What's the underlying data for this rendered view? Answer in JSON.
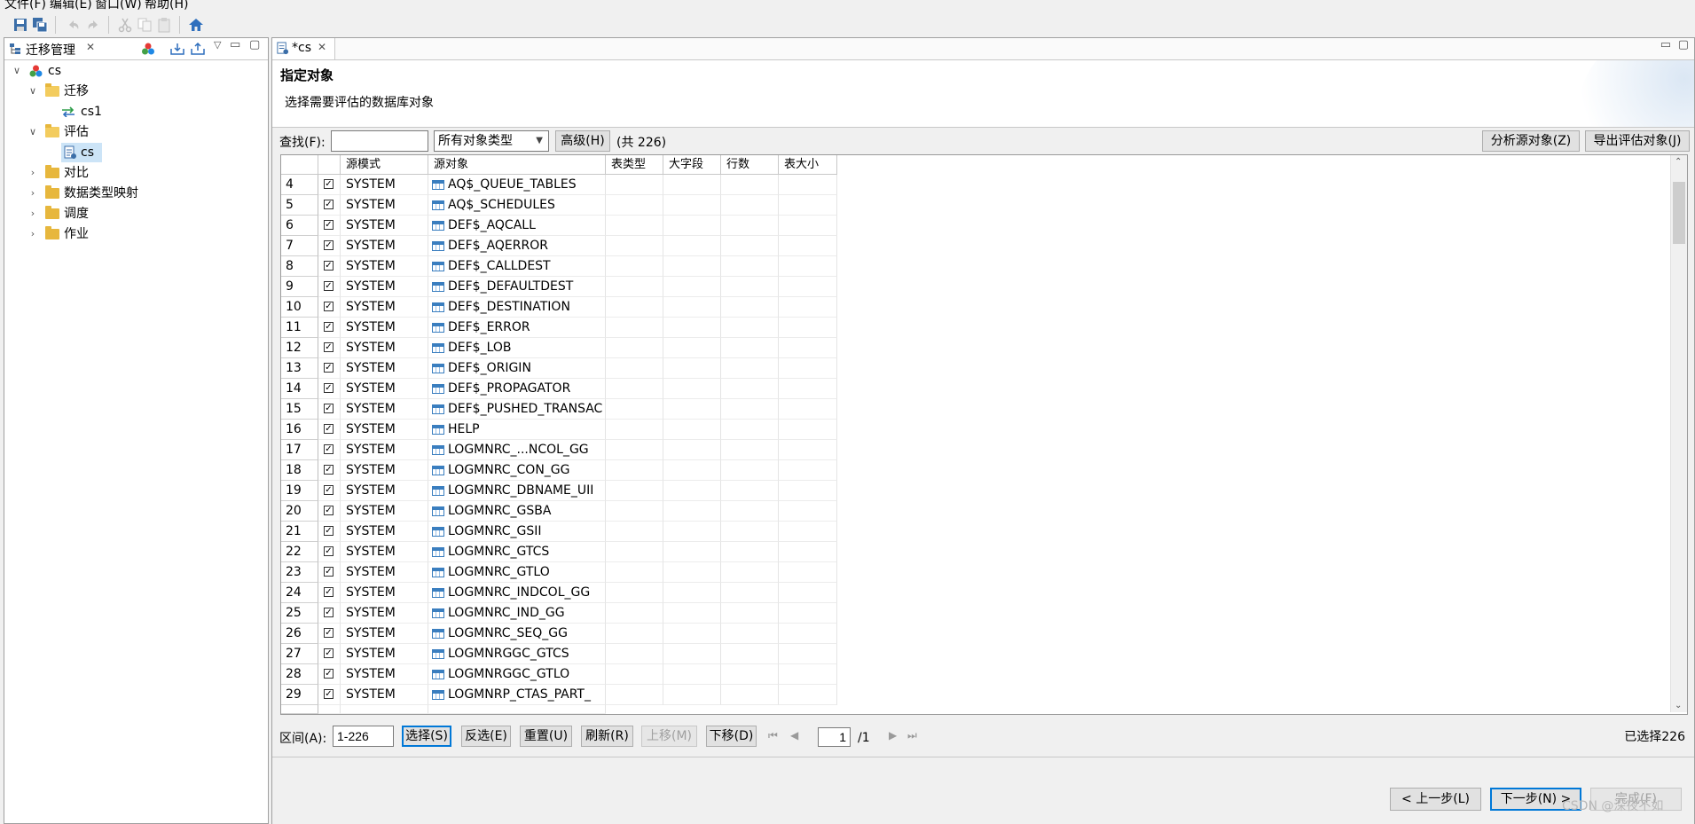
{
  "menu": [
    {
      "label": "文件(F)"
    },
    {
      "label": "编辑(E)"
    },
    {
      "label": "窗口(W)"
    },
    {
      "label": "帮助(H)"
    }
  ],
  "toolbar_icons": [
    "save-icon",
    "save-all-icon",
    "undo-icon",
    "redo-icon",
    "cut-icon",
    "copy-icon",
    "paste-icon",
    "home-icon"
  ],
  "left_view": {
    "title": "迁移管理",
    "tree": [
      {
        "label": "cs",
        "icon": "project-icon"
      },
      {
        "label": "迁移",
        "icon": "folder-open-icon"
      },
      {
        "label": "cs1",
        "icon": "migration-icon"
      },
      {
        "label": "评估",
        "icon": "folder-open-icon"
      },
      {
        "label": "cs",
        "icon": "document-icon"
      },
      {
        "label": "对比",
        "icon": "folder-icon"
      },
      {
        "label": "数据类型映射",
        "icon": "folder-icon"
      },
      {
        "label": "调度",
        "icon": "folder-icon"
      },
      {
        "label": "作业",
        "icon": "folder-icon"
      }
    ]
  },
  "editor": {
    "tab_title": "*cs",
    "header_title": "指定对象",
    "header_desc": "选择需要评估的数据库对象",
    "find_label": "查找(F):",
    "find_value": "",
    "type_select": "所有对象类型",
    "advanced_btn": "高级(H)",
    "total": "(共 226)",
    "analyze_btn": "分析源对象(Z)",
    "export_btn": "导出评估对象(J)"
  },
  "table": {
    "columns": [
      "",
      "",
      "源模式",
      "源对象",
      "表类型",
      "大字段",
      "行数",
      "表大小"
    ],
    "rows": [
      {
        "no": "4",
        "checked": "☑",
        "schema": "SYSTEM",
        "object": "AQ$_QUEUE_TABLES"
      },
      {
        "no": "5",
        "checked": "☑",
        "schema": "SYSTEM",
        "object": "AQ$_SCHEDULES"
      },
      {
        "no": "6",
        "checked": "☑",
        "schema": "SYSTEM",
        "object": "DEF$_AQCALL"
      },
      {
        "no": "7",
        "checked": "☑",
        "schema": "SYSTEM",
        "object": "DEF$_AQERROR"
      },
      {
        "no": "8",
        "checked": "☑",
        "schema": "SYSTEM",
        "object": "DEF$_CALLDEST"
      },
      {
        "no": "9",
        "checked": "☑",
        "schema": "SYSTEM",
        "object": "DEF$_DEFAULTDEST"
      },
      {
        "no": "10",
        "checked": "☑",
        "schema": "SYSTEM",
        "object": "DEF$_DESTINATION"
      },
      {
        "no": "11",
        "checked": "☑",
        "schema": "SYSTEM",
        "object": "DEF$_ERROR"
      },
      {
        "no": "12",
        "checked": "☑",
        "schema": "SYSTEM",
        "object": "DEF$_LOB"
      },
      {
        "no": "13",
        "checked": "☑",
        "schema": "SYSTEM",
        "object": "DEF$_ORIGIN"
      },
      {
        "no": "14",
        "checked": "☑",
        "schema": "SYSTEM",
        "object": "DEF$_PROPAGATOR"
      },
      {
        "no": "15",
        "checked": "☑",
        "schema": "SYSTEM",
        "object": "DEF$_PUSHED_TRANSAC"
      },
      {
        "no": "16",
        "checked": "☑",
        "schema": "SYSTEM",
        "object": "HELP"
      },
      {
        "no": "17",
        "checked": "☑",
        "schema": "SYSTEM",
        "object": "LOGMNRC_...NCOL_GG"
      },
      {
        "no": "18",
        "checked": "☑",
        "schema": "SYSTEM",
        "object": "LOGMNRC_CON_GG"
      },
      {
        "no": "19",
        "checked": "☑",
        "schema": "SYSTEM",
        "object": "LOGMNRC_DBNAME_UII"
      },
      {
        "no": "20",
        "checked": "☑",
        "schema": "SYSTEM",
        "object": "LOGMNRC_GSBA"
      },
      {
        "no": "21",
        "checked": "☑",
        "schema": "SYSTEM",
        "object": "LOGMNRC_GSII"
      },
      {
        "no": "22",
        "checked": "☑",
        "schema": "SYSTEM",
        "object": "LOGMNRC_GTCS"
      },
      {
        "no": "23",
        "checked": "☑",
        "schema": "SYSTEM",
        "object": "LOGMNRC_GTLO"
      },
      {
        "no": "24",
        "checked": "☑",
        "schema": "SYSTEM",
        "object": "LOGMNRC_INDCOL_GG"
      },
      {
        "no": "25",
        "checked": "☑",
        "schema": "SYSTEM",
        "object": "LOGMNRC_IND_GG"
      },
      {
        "no": "26",
        "checked": "☑",
        "schema": "SYSTEM",
        "object": "LOGMNRC_SEQ_GG"
      },
      {
        "no": "27",
        "checked": "☑",
        "schema": "SYSTEM",
        "object": "LOGMNRGGC_GTCS"
      },
      {
        "no": "28",
        "checked": "☑",
        "schema": "SYSTEM",
        "object": "LOGMNRGGC_GTLO"
      },
      {
        "no": "29",
        "checked": "☑",
        "schema": "SYSTEM",
        "object": "LOGMNRP_CTAS_PART_"
      }
    ]
  },
  "bottom": {
    "range_label": "区间(A):",
    "range_value": "1-226",
    "buttons": [
      {
        "label": "选择(S)",
        "state": "focused"
      },
      {
        "label": "反选(E)",
        "state": "normal"
      },
      {
        "label": "重置(U)",
        "state": "normal"
      },
      {
        "label": "刷新(R)",
        "state": "normal"
      },
      {
        "label": "上移(M)",
        "state": "disabled"
      },
      {
        "label": "下移(D)",
        "state": "normal"
      }
    ],
    "page_value": "1",
    "page_total": "/1",
    "selected": "已选择226"
  },
  "wizard": {
    "prev": "< 上一步(L)",
    "next": "下一步(N) >",
    "finish": "完成(F)",
    "watermark": "CSDN @深夜不如"
  },
  "colors": {
    "accent": "#0078d7",
    "folder": "#e7b73d",
    "table_icon": "#3a7ebf"
  }
}
